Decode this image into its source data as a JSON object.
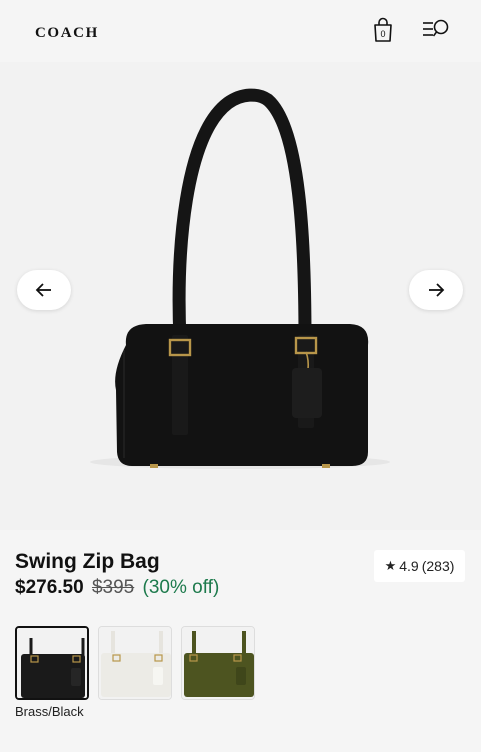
{
  "header": {
    "logo_text": "COACH",
    "cart_count": "0",
    "icons": {
      "cart": "shopping-bag-icon",
      "menu": "menu-search-icon"
    }
  },
  "hero": {
    "icons": {
      "prev": "arrow-left-icon",
      "next": "arrow-right-icon"
    }
  },
  "product": {
    "name": "Swing Zip Bag",
    "price": "$276.50",
    "original_price": "$395",
    "discount": "(30% off)",
    "rating_value": "4.9",
    "rating_count": "(283)",
    "selected_color": "Brass/Black"
  },
  "colors": {
    "discount_green": "#1d7a4c",
    "swatches": [
      "#1a1a1a",
      "#ecebe6",
      "#4d5420"
    ]
  }
}
